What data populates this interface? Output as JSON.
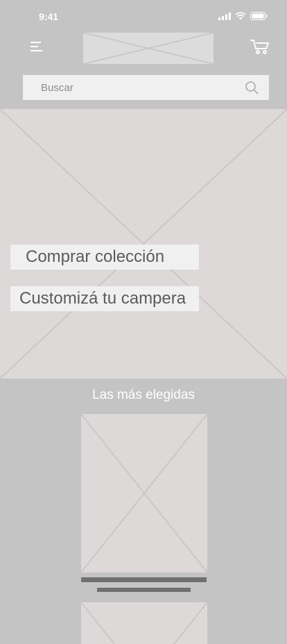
{
  "status_bar": {
    "time": "9:41",
    "icons": [
      "signal-icon",
      "wifi-icon",
      "battery-icon"
    ]
  },
  "header": {
    "menu_icon": "hamburger-menu-icon",
    "logo": "logo-placeholder",
    "cart_icon": "cart-icon"
  },
  "search": {
    "placeholder": "Buscar",
    "icon": "search-icon"
  },
  "hero": {
    "primary_cta": "Comprar colección",
    "secondary_cta": "Customizá tu campera"
  },
  "featured": {
    "title": "Las más elegidas"
  },
  "colors": {
    "background": "#c4c4c4",
    "placeholder": "#dcd9d8",
    "button": "#f0f0f0",
    "text_dark": "#5b5b5b",
    "line": "#707070"
  }
}
